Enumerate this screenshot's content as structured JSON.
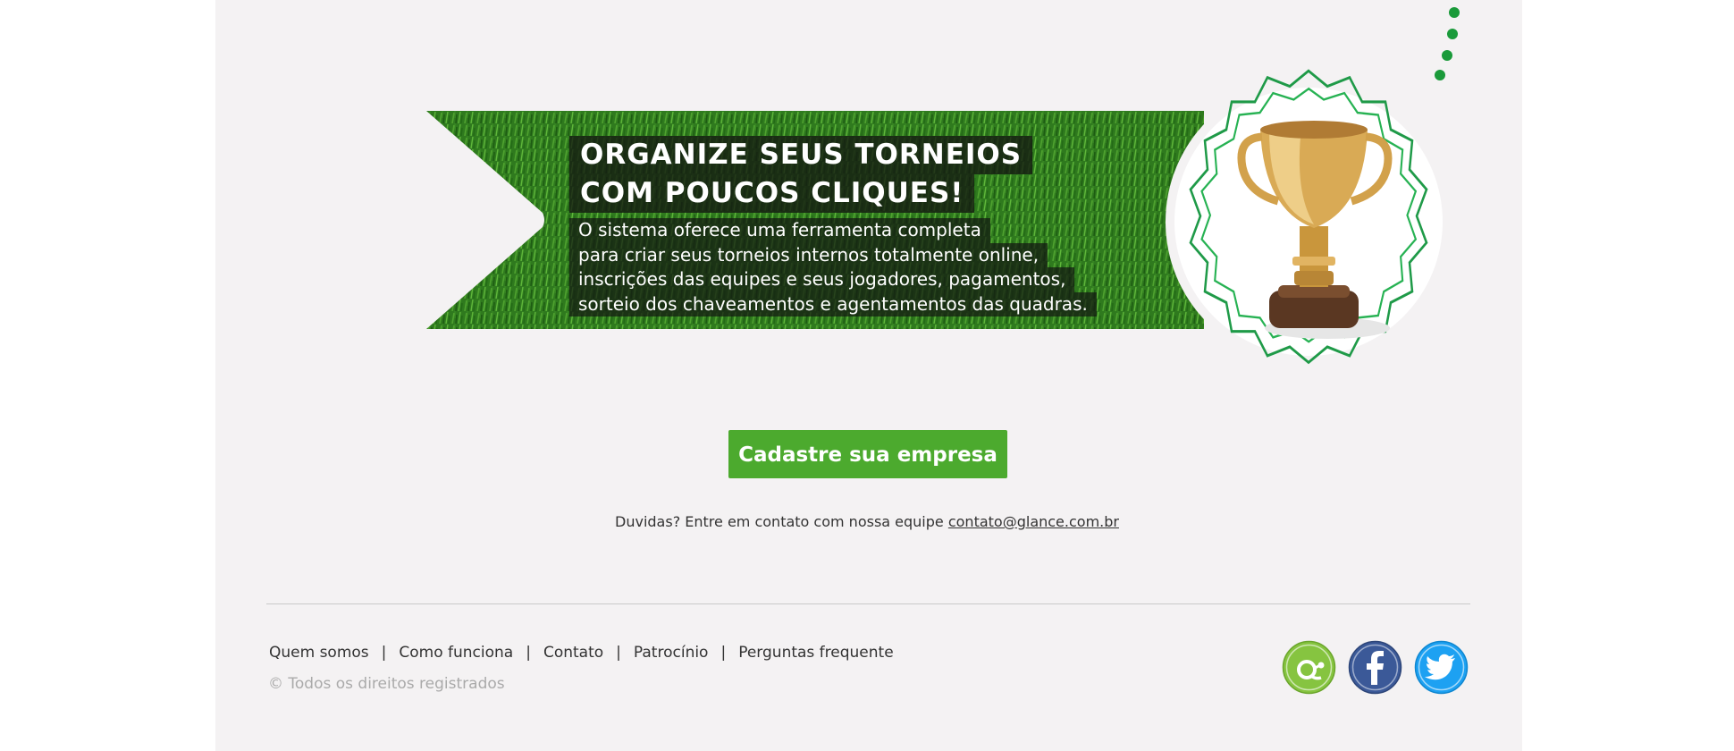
{
  "banner": {
    "headline_line1": "ORGANIZE SEUS TORNEIOS",
    "headline_line2": "COM POUCOS CLIQUES!",
    "description_lines": [
      "O sistema oferece uma ferramenta completa",
      "para criar seus torneios internos totalmente online,",
      "inscrições das equipes e seus jogadores, pagamentos,",
      "sorteio dos chaveamentos e agentamentos das quadras."
    ]
  },
  "cta": {
    "label": "Cadastre sua empresa"
  },
  "contact": {
    "text": "Duvidas? Entre em contato com nossa equipe",
    "email": "contato@glance.com.br"
  },
  "footer": {
    "links": [
      "Quem somos",
      "Como funciona",
      "Contato",
      "Patrocínio",
      "Perguntas frequente"
    ],
    "separator": "|",
    "copyright": "© Todos os direitos registrados"
  },
  "social": [
    {
      "icon": "glance-icon",
      "color": "#86c440"
    },
    {
      "icon": "facebook-icon",
      "color": "#3b5998"
    },
    {
      "icon": "twitter-icon",
      "color": "#1da1f2"
    }
  ],
  "colors": {
    "page_bg": "#f4f2f3",
    "accent_green": "#4caa2e",
    "ribbon_outline": "#1f9a48"
  }
}
